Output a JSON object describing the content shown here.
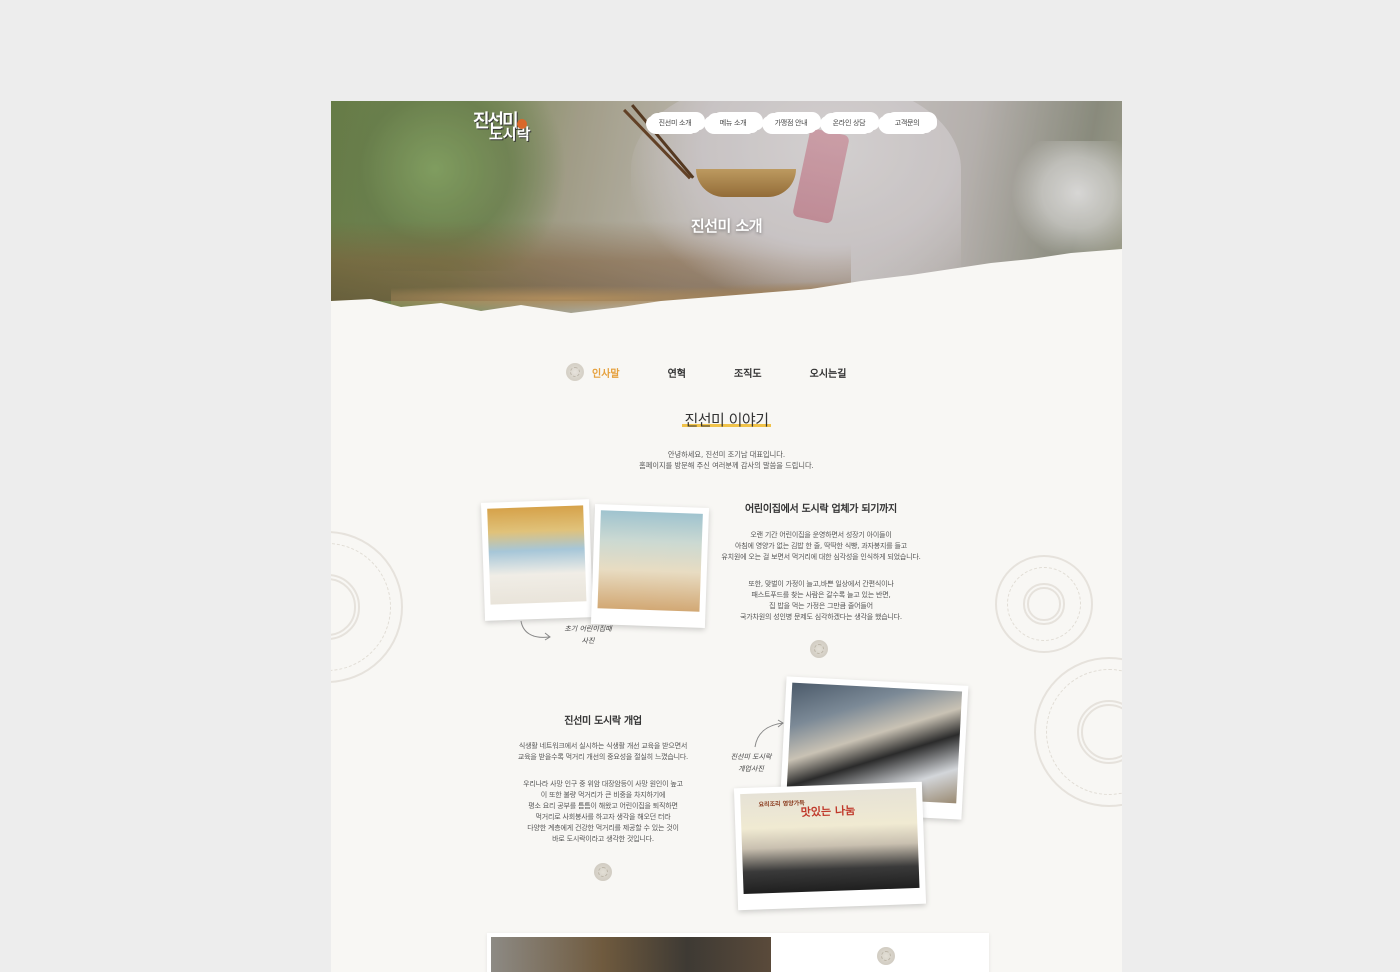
{
  "header": {
    "logo_line1": "진선미",
    "logo_line2": "도시락",
    "nav": [
      "진선미 소개",
      "메뉴 소개",
      "가맹점 안내",
      "온라인 상담",
      "고객문의"
    ],
    "hero_title": "진선미 소개"
  },
  "tabs": [
    {
      "label": "인사말",
      "active": true
    },
    {
      "label": "연혁",
      "active": false
    },
    {
      "label": "조직도",
      "active": false
    },
    {
      "label": "오시는길",
      "active": false
    }
  ],
  "story": {
    "title": "진선미 이야기",
    "intro_line1": "안녕하세요, 진선미 조기남 대표입니다.",
    "intro_line2": "홈페이지를 방문해 주신 여러분께 감사의 말씀을 드립니다."
  },
  "section1": {
    "title": "어린이집에서 도시락 업체가 되기까지",
    "para1": [
      "오랜 기간 어린이집을 운영하면서 성장기 아이들이",
      "아침에 영양가 없는 김밥 한 줄, 딱딱한 식빵, 과자봉지를 들고",
      "유치원에 오는 걸 보면서 먹거리에 대한 심각성을 인식하게 되었습니다."
    ],
    "para2": [
      "또한, 맞벌이 가정이 늘고,바쁜 일상에서 간편식이나",
      "패스트푸드를 찾는 사람은 갈수록 늘고 있는 반면,",
      "집 밥을 먹는 가정은 그만큼 줄어들어",
      "국가차원의 성인병 문제도 심각하겠다는 생각을 했습니다."
    ],
    "caption_line1": "초기 어린이집때",
    "caption_line2": "사진"
  },
  "section2": {
    "title": "진선미 도시락 개업",
    "para1": [
      "식생활 네트워크에서 실시하는 식생활 개선 교육을 받으면서",
      "교육을 받을수록 먹거리 개선의 중요성을 절실히 느꼈습니다."
    ],
    "para2": [
      "우리나라 사망 인구 중 위암 대장암등이 사망 원인이 높고",
      "이 또한 불량 먹거리가 큰 비중을 차지하기에",
      "평소 요리 공부를 틈틈이 해왔고 어린이집을 퇴직하면",
      "먹거리로 사회봉사를 하고자 생각을 해오던 터라",
      "다양한 계층에게 건강한 먹거리를 제공할 수 있는 것이",
      "바로 도시락이라고 생각한 것입니다."
    ],
    "caption_line1": "진선미 도시락",
    "caption_line2": "개업사진",
    "banner_small": "요리조리 영양가득",
    "banner_big": "맛있는 나눔"
  },
  "colors": {
    "background": "#ededed",
    "page": "#f8f7f4",
    "accent": "#e5a03c",
    "highlight": "#f1c34a"
  }
}
